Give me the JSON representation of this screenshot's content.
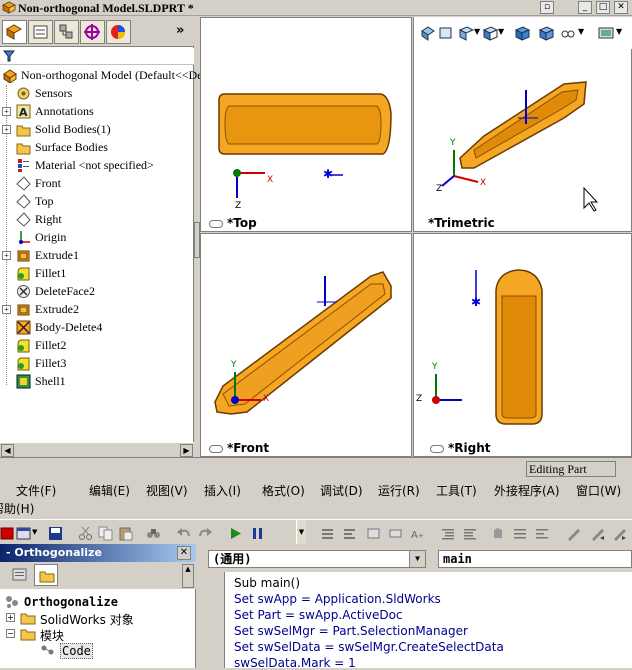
{
  "window": {
    "title": "Non-orthogonal Model.SLDPRT *",
    "buttons": [
      "▫",
      "_",
      "□",
      "✕"
    ]
  },
  "feature_tree": {
    "more": "»",
    "items": [
      {
        "label": "Non-orthogonal Model  (Default<<De",
        "icon": "part-icon",
        "expander": ""
      },
      {
        "label": "Sensors",
        "icon": "sensor-icon",
        "expander": ""
      },
      {
        "label": "Annotations",
        "icon": "annotation-icon",
        "expander": "+"
      },
      {
        "label": "Solid Bodies(1)",
        "icon": "solid-bodies-icon",
        "expander": "+"
      },
      {
        "label": "Surface Bodies",
        "icon": "surface-bodies-icon",
        "expander": ""
      },
      {
        "label": "Material <not specified>",
        "icon": "material-icon",
        "expander": ""
      },
      {
        "label": "Front",
        "icon": "plane-icon",
        "expander": ""
      },
      {
        "label": "Top",
        "icon": "plane-icon",
        "expander": ""
      },
      {
        "label": "Right",
        "icon": "plane-icon",
        "expander": ""
      },
      {
        "label": "Origin",
        "icon": "origin-icon",
        "expander": ""
      },
      {
        "label": "Extrude1",
        "icon": "extrude-icon",
        "expander": "+"
      },
      {
        "label": "Fillet1",
        "icon": "fillet-icon",
        "expander": ""
      },
      {
        "label": "DeleteFace2",
        "icon": "delete-face-icon",
        "expander": ""
      },
      {
        "label": "Extrude2",
        "icon": "extrude-icon",
        "expander": "+"
      },
      {
        "label": "Body-Delete4",
        "icon": "body-delete-icon",
        "expander": ""
      },
      {
        "label": "Fillet2",
        "icon": "fillet-icon",
        "expander": ""
      },
      {
        "label": "Fillet3",
        "icon": "fillet-icon",
        "expander": ""
      },
      {
        "label": "Shell1",
        "icon": "shell-icon",
        "expander": ""
      }
    ]
  },
  "viewports": {
    "top": "*Top",
    "trimetric": "*Trimetric",
    "front": "*Front",
    "right": "*Right"
  },
  "axis_labels": {
    "x": "X",
    "y": "Y",
    "z": "Z"
  },
  "status": {
    "mode": "Editing Part"
  },
  "vba": {
    "menus": [
      "文件(F)",
      "编辑(E)",
      "视图(V)",
      "插入(I)",
      "格式(O)",
      "调试(D)",
      "运行(R)",
      "工具(T)",
      "外接程序(A)",
      "窗口(W)",
      "帮助(H)"
    ],
    "project_title": "- Orthogonalize",
    "project_close": "✕",
    "project_tree": {
      "root": "Orthogonalize",
      "solidworks_objects": "SolidWorks 对象",
      "modules": "模块",
      "code": "Code"
    },
    "object_combo": "(通用)",
    "proc_combo": "main",
    "code_lines": [
      "Sub main()",
      "Set swApp = Application.SldWorks",
      "Set Part = swApp.ActiveDoc",
      "Set swSelMgr = Part.SelectionManager",
      "Set swSelData = swSelMgr.CreateSelectData",
      "swSelData.Mark = 1"
    ]
  },
  "colors": {
    "part_fill": "#f5a623",
    "part_edge": "#6b3a00",
    "axis_x": "#cc0000",
    "axis_y": "#007a00",
    "axis_z": "#0000cc",
    "title_gradient_start": "#0a246a"
  }
}
